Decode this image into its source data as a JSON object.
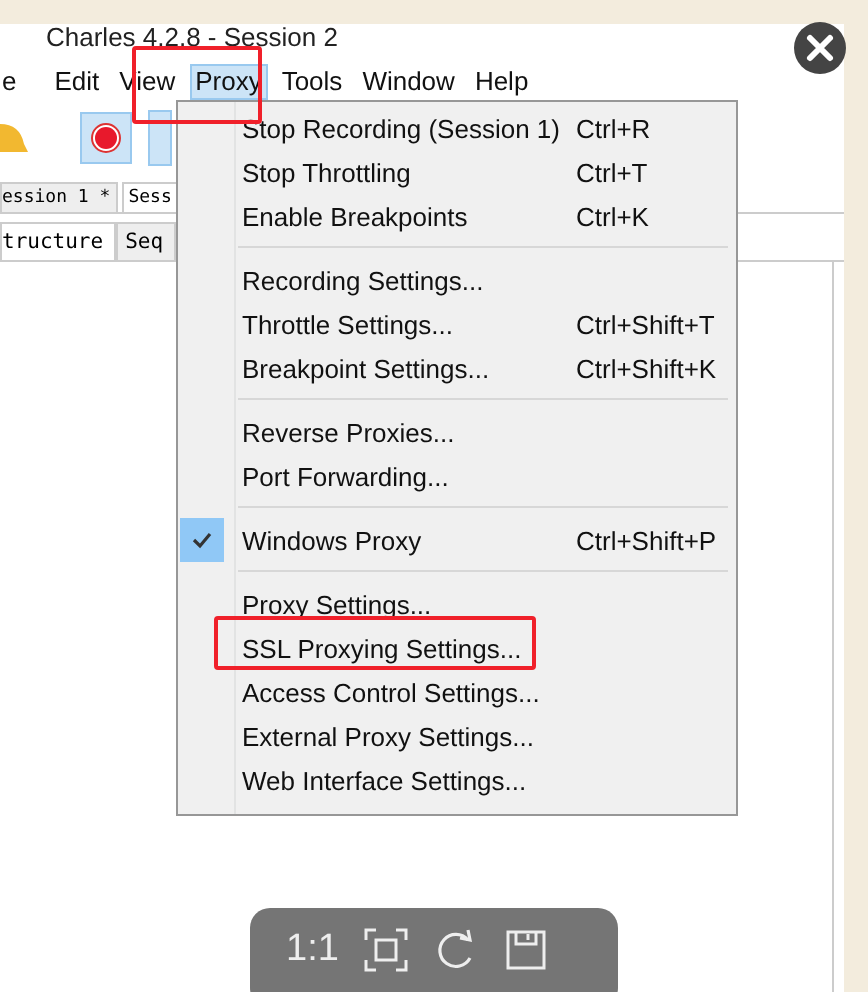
{
  "window": {
    "title": "Charles 4.2.8 - Session 2"
  },
  "menu_bar": [
    {
      "label": "e",
      "selected": false
    },
    {
      "label": "Edit",
      "selected": false
    },
    {
      "label": "View",
      "selected": false
    },
    {
      "label": "Proxy",
      "selected": true
    },
    {
      "label": "Tools",
      "selected": false
    },
    {
      "label": "Window",
      "selected": false
    },
    {
      "label": "Help",
      "selected": false
    }
  ],
  "session_tabs": [
    {
      "label": "ession 1 *",
      "selected": false
    },
    {
      "label": "Sess",
      "selected": true
    }
  ],
  "view_tabs": [
    {
      "label": "tructure",
      "selected": true
    },
    {
      "label": "Seq",
      "selected": false
    }
  ],
  "proxy_menu": [
    [
      {
        "label": "Stop Recording (Session 1)",
        "shortcut": "Ctrl+R",
        "checked": false
      },
      {
        "label": "Stop Throttling",
        "shortcut": "Ctrl+T",
        "checked": false
      },
      {
        "label": "Enable Breakpoints",
        "shortcut": "Ctrl+K",
        "checked": false
      }
    ],
    [
      {
        "label": "Recording Settings...",
        "checked": false
      },
      {
        "label": "Throttle Settings...",
        "shortcut": "Ctrl+Shift+T",
        "checked": false
      },
      {
        "label": "Breakpoint Settings...",
        "shortcut": "Ctrl+Shift+K",
        "checked": false
      }
    ],
    [
      {
        "label": "Reverse Proxies...",
        "checked": false
      },
      {
        "label": "Port Forwarding...",
        "checked": false
      }
    ],
    [
      {
        "label": "Windows Proxy",
        "shortcut": "Ctrl+Shift+P",
        "checked": true
      }
    ],
    [
      {
        "label": "Proxy Settings...",
        "checked": false
      },
      {
        "label": "SSL Proxying Settings...",
        "checked": false
      },
      {
        "label": "Access Control Settings...",
        "checked": false
      },
      {
        "label": "External Proxy Settings...",
        "checked": false
      },
      {
        "label": "Web Interface Settings...",
        "checked": false
      }
    ]
  ],
  "viewer_toolbar": {
    "zoom_label": "1:1"
  }
}
